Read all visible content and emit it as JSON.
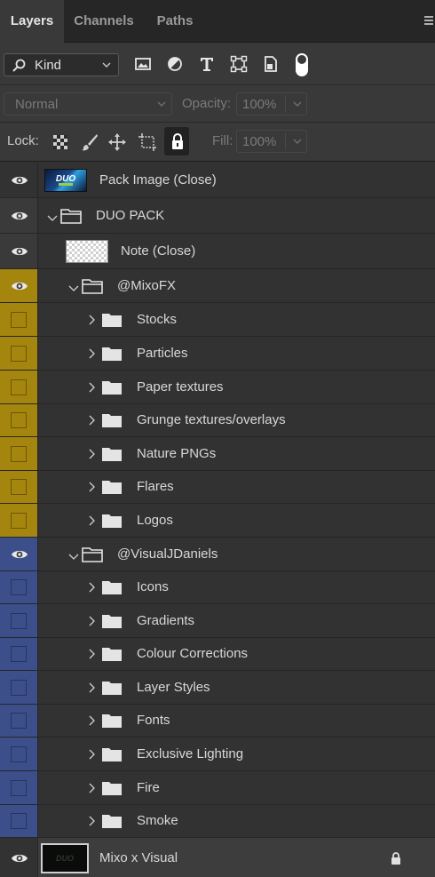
{
  "tabs": {
    "layers": "Layers",
    "channels": "Channels",
    "paths": "Paths"
  },
  "filter": {
    "kind_label": "Kind",
    "buttons": [
      "pixel-filter-icon",
      "adjustment-filter-icon",
      "type-filter-icon",
      "shape-filter-icon",
      "smart-object-filter-icon",
      "filter-toggle-icon"
    ]
  },
  "blend": {
    "mode": "Normal",
    "opacity_label": "Opacity:",
    "opacity_value": "100%"
  },
  "lock": {
    "label": "Lock:",
    "fill_label": "Fill:",
    "fill_value": "100%"
  },
  "colors": {
    "yellow_tag": "#a4860e",
    "blue_tag": "#3c4f8a",
    "panel": "#323232"
  },
  "layers": [
    {
      "name": "Pack Image (Close)",
      "type": "image",
      "depth": 0,
      "visible": true,
      "tag": "none"
    },
    {
      "name": "DUO PACK",
      "type": "group",
      "depth": 0,
      "expanded": true,
      "visible": true,
      "tag": "none"
    },
    {
      "name": "Note (Close)",
      "type": "transparent",
      "depth": 1,
      "visible": true,
      "tag": "none"
    },
    {
      "name": "@MixoFX",
      "type": "group",
      "depth": 1,
      "expanded": true,
      "visible": true,
      "tag": "yellow"
    },
    {
      "name": "Stocks",
      "type": "group",
      "depth": 2,
      "expanded": false,
      "visible": false,
      "tag": "yellow"
    },
    {
      "name": "Particles",
      "type": "group",
      "depth": 2,
      "expanded": false,
      "visible": false,
      "tag": "yellow"
    },
    {
      "name": "Paper textures",
      "type": "group",
      "depth": 2,
      "expanded": false,
      "visible": false,
      "tag": "yellow"
    },
    {
      "name": "Grunge textures/overlays",
      "type": "group",
      "depth": 2,
      "expanded": false,
      "visible": false,
      "tag": "yellow"
    },
    {
      "name": "Nature PNGs",
      "type": "group",
      "depth": 2,
      "expanded": false,
      "visible": false,
      "tag": "yellow"
    },
    {
      "name": "Flares",
      "type": "group",
      "depth": 2,
      "expanded": false,
      "visible": false,
      "tag": "yellow"
    },
    {
      "name": "Logos",
      "type": "group",
      "depth": 2,
      "expanded": false,
      "visible": false,
      "tag": "yellow"
    },
    {
      "name": "@VisualJDaniels",
      "type": "group",
      "depth": 1,
      "expanded": true,
      "visible": true,
      "tag": "blue"
    },
    {
      "name": "Icons",
      "type": "group",
      "depth": 2,
      "expanded": false,
      "visible": false,
      "tag": "blue"
    },
    {
      "name": "Gradients",
      "type": "group",
      "depth": 2,
      "expanded": false,
      "visible": false,
      "tag": "blue"
    },
    {
      "name": "Colour Corrections",
      "type": "group",
      "depth": 2,
      "expanded": false,
      "visible": false,
      "tag": "blue"
    },
    {
      "name": "Layer Styles",
      "type": "group",
      "depth": 2,
      "expanded": false,
      "visible": false,
      "tag": "blue"
    },
    {
      "name": "Fonts",
      "type": "group",
      "depth": 2,
      "expanded": false,
      "visible": false,
      "tag": "blue"
    },
    {
      "name": "Exclusive Lighting",
      "type": "group",
      "depth": 2,
      "expanded": false,
      "visible": false,
      "tag": "blue"
    },
    {
      "name": "Fire",
      "type": "group",
      "depth": 2,
      "expanded": false,
      "visible": false,
      "tag": "blue"
    },
    {
      "name": "Smoke",
      "type": "group",
      "depth": 2,
      "expanded": false,
      "visible": false,
      "tag": "blue"
    },
    {
      "name": "Mixo x Visual",
      "type": "background",
      "depth": 0,
      "visible": true,
      "tag": "none",
      "locked": true,
      "selected": true
    }
  ]
}
